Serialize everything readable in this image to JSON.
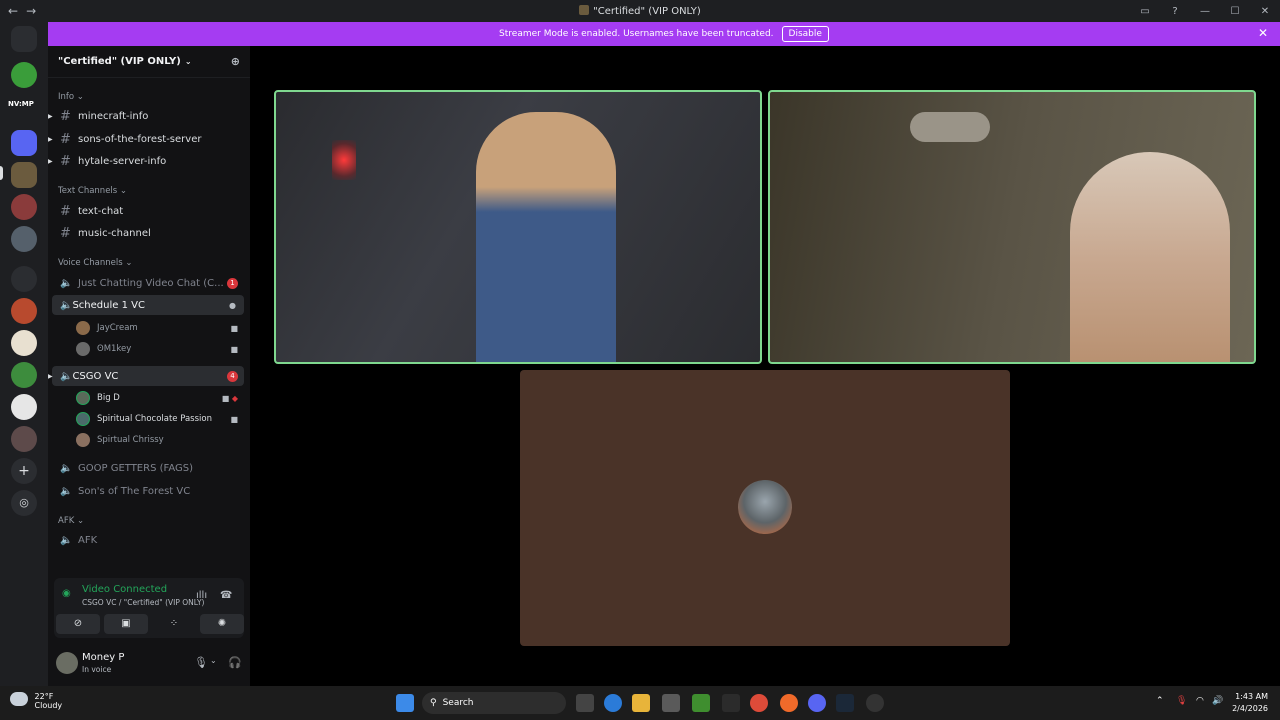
{
  "window": {
    "title": "\"Certified\" (VIP ONLY)"
  },
  "banner": {
    "text": "Streamer Mode is enabled. Usernames have been truncated.",
    "button": "Disable"
  },
  "guild": {
    "name": "\"Certified\" (VIP ONLY)"
  },
  "categories": {
    "info": "Info",
    "text": "Text Channels",
    "voice": "Voice Channels",
    "afk": "AFK"
  },
  "channels": {
    "info": [
      "minecraft-info",
      "sons-of-the-forest-server",
      "hytale-server-info"
    ],
    "text": [
      "text-chat",
      "music-channel"
    ],
    "voice": {
      "just_chatting": "Just Chatting Video Chat (C...",
      "just_chatting_badge": "1",
      "schedule": "Schedule 1 VC",
      "schedule_users": [
        "JayCream",
        "ʘM1key"
      ],
      "csgo": "CSGO VC",
      "csgo_badge": "4",
      "csgo_users": [
        "Big D",
        "Spiritual Chocolate Passion",
        "Spirtual Chrissy"
      ],
      "goop": "GOOP GETTERS (FAGS)",
      "sons": "Son's of The Forest VC"
    },
    "afk": "AFK"
  },
  "server_label": "NV:MP",
  "voice_panel": {
    "status": "Video Connected",
    "channel": "CSGO VC / \"Certified\" (VIP ONLY)"
  },
  "user_panel": {
    "name": "Money P",
    "status": "In voice"
  },
  "taskbar": {
    "temp": "22°F",
    "condition": "Cloudy",
    "search": "Search",
    "time": "1:43 AM",
    "date": "2/4/2026"
  },
  "colors": {
    "accent": "#a53cf2",
    "voice_green": "#23a55a",
    "speaking": "#7fd88f",
    "badge_red": "#da373c"
  }
}
